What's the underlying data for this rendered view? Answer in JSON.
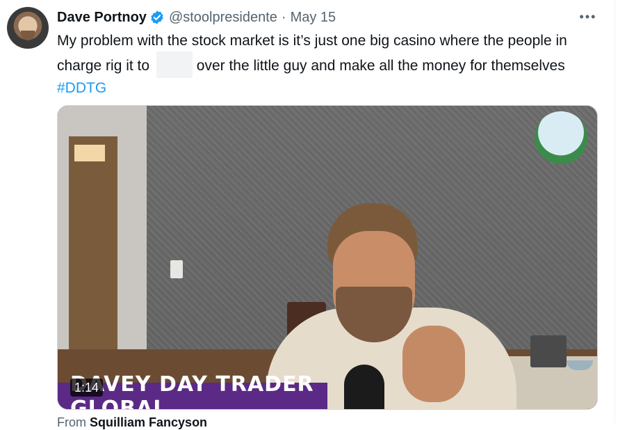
{
  "author": {
    "display_name": "Dave Portnoy",
    "handle": "@stoolpresidente",
    "date": "May 15",
    "separator": "·"
  },
  "more_label": "•••",
  "tweet": {
    "text_before": "My problem with the stock market is it’s just one big casino where the people in charge rig it to",
    "text_after": "over the little guy and make all the money for themselves",
    "hashtag": "#DDTG"
  },
  "media": {
    "duration": "1:14",
    "overlay_title": "DAVEY DAY TRADER GLOBAL"
  },
  "attribution": {
    "prefix": "From",
    "source": "Squilliam Fancyson"
  },
  "colors": {
    "verified": "#1d9bf0",
    "link": "#1d9bf0",
    "overlay": "#5b2a86"
  }
}
